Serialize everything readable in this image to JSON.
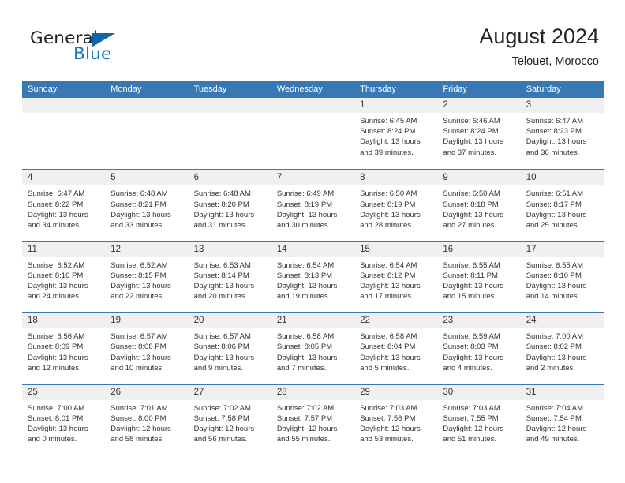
{
  "brand": {
    "name_part1": "General",
    "name_part2": "Blue",
    "accent_color": "#1878be"
  },
  "header": {
    "title": "August 2024",
    "location": "Telouet, Morocco"
  },
  "calendar": {
    "header_bg": "#3878b4",
    "day_band_bg": "#f0f0f0",
    "weekdays": [
      "Sunday",
      "Monday",
      "Tuesday",
      "Wednesday",
      "Thursday",
      "Friday",
      "Saturday"
    ],
    "weeks": [
      [
        {
          "day": "",
          "empty": true
        },
        {
          "day": "",
          "empty": true
        },
        {
          "day": "",
          "empty": true
        },
        {
          "day": "",
          "empty": true
        },
        {
          "day": "1",
          "sunrise": "Sunrise: 6:45 AM",
          "sunset": "Sunset: 8:24 PM",
          "daylight1": "Daylight: 13 hours",
          "daylight2": "and 39 minutes."
        },
        {
          "day": "2",
          "sunrise": "Sunrise: 6:46 AM",
          "sunset": "Sunset: 8:24 PM",
          "daylight1": "Daylight: 13 hours",
          "daylight2": "and 37 minutes."
        },
        {
          "day": "3",
          "sunrise": "Sunrise: 6:47 AM",
          "sunset": "Sunset: 8:23 PM",
          "daylight1": "Daylight: 13 hours",
          "daylight2": "and 36 minutes."
        }
      ],
      [
        {
          "day": "4",
          "sunrise": "Sunrise: 6:47 AM",
          "sunset": "Sunset: 8:22 PM",
          "daylight1": "Daylight: 13 hours",
          "daylight2": "and 34 minutes."
        },
        {
          "day": "5",
          "sunrise": "Sunrise: 6:48 AM",
          "sunset": "Sunset: 8:21 PM",
          "daylight1": "Daylight: 13 hours",
          "daylight2": "and 33 minutes."
        },
        {
          "day": "6",
          "sunrise": "Sunrise: 6:48 AM",
          "sunset": "Sunset: 8:20 PM",
          "daylight1": "Daylight: 13 hours",
          "daylight2": "and 31 minutes."
        },
        {
          "day": "7",
          "sunrise": "Sunrise: 6:49 AM",
          "sunset": "Sunset: 8:19 PM",
          "daylight1": "Daylight: 13 hours",
          "daylight2": "and 30 minutes."
        },
        {
          "day": "8",
          "sunrise": "Sunrise: 6:50 AM",
          "sunset": "Sunset: 8:19 PM",
          "daylight1": "Daylight: 13 hours",
          "daylight2": "and 28 minutes."
        },
        {
          "day": "9",
          "sunrise": "Sunrise: 6:50 AM",
          "sunset": "Sunset: 8:18 PM",
          "daylight1": "Daylight: 13 hours",
          "daylight2": "and 27 minutes."
        },
        {
          "day": "10",
          "sunrise": "Sunrise: 6:51 AM",
          "sunset": "Sunset: 8:17 PM",
          "daylight1": "Daylight: 13 hours",
          "daylight2": "and 25 minutes."
        }
      ],
      [
        {
          "day": "11",
          "sunrise": "Sunrise: 6:52 AM",
          "sunset": "Sunset: 8:16 PM",
          "daylight1": "Daylight: 13 hours",
          "daylight2": "and 24 minutes."
        },
        {
          "day": "12",
          "sunrise": "Sunrise: 6:52 AM",
          "sunset": "Sunset: 8:15 PM",
          "daylight1": "Daylight: 13 hours",
          "daylight2": "and 22 minutes."
        },
        {
          "day": "13",
          "sunrise": "Sunrise: 6:53 AM",
          "sunset": "Sunset: 8:14 PM",
          "daylight1": "Daylight: 13 hours",
          "daylight2": "and 20 minutes."
        },
        {
          "day": "14",
          "sunrise": "Sunrise: 6:54 AM",
          "sunset": "Sunset: 8:13 PM",
          "daylight1": "Daylight: 13 hours",
          "daylight2": "and 19 minutes."
        },
        {
          "day": "15",
          "sunrise": "Sunrise: 6:54 AM",
          "sunset": "Sunset: 8:12 PM",
          "daylight1": "Daylight: 13 hours",
          "daylight2": "and 17 minutes."
        },
        {
          "day": "16",
          "sunrise": "Sunrise: 6:55 AM",
          "sunset": "Sunset: 8:11 PM",
          "daylight1": "Daylight: 13 hours",
          "daylight2": "and 15 minutes."
        },
        {
          "day": "17",
          "sunrise": "Sunrise: 6:55 AM",
          "sunset": "Sunset: 8:10 PM",
          "daylight1": "Daylight: 13 hours",
          "daylight2": "and 14 minutes."
        }
      ],
      [
        {
          "day": "18",
          "sunrise": "Sunrise: 6:56 AM",
          "sunset": "Sunset: 8:09 PM",
          "daylight1": "Daylight: 13 hours",
          "daylight2": "and 12 minutes."
        },
        {
          "day": "19",
          "sunrise": "Sunrise: 6:57 AM",
          "sunset": "Sunset: 8:08 PM",
          "daylight1": "Daylight: 13 hours",
          "daylight2": "and 10 minutes."
        },
        {
          "day": "20",
          "sunrise": "Sunrise: 6:57 AM",
          "sunset": "Sunset: 8:06 PM",
          "daylight1": "Daylight: 13 hours",
          "daylight2": "and 9 minutes."
        },
        {
          "day": "21",
          "sunrise": "Sunrise: 6:58 AM",
          "sunset": "Sunset: 8:05 PM",
          "daylight1": "Daylight: 13 hours",
          "daylight2": "and 7 minutes."
        },
        {
          "day": "22",
          "sunrise": "Sunrise: 6:58 AM",
          "sunset": "Sunset: 8:04 PM",
          "daylight1": "Daylight: 13 hours",
          "daylight2": "and 5 minutes."
        },
        {
          "day": "23",
          "sunrise": "Sunrise: 6:59 AM",
          "sunset": "Sunset: 8:03 PM",
          "daylight1": "Daylight: 13 hours",
          "daylight2": "and 4 minutes."
        },
        {
          "day": "24",
          "sunrise": "Sunrise: 7:00 AM",
          "sunset": "Sunset: 8:02 PM",
          "daylight1": "Daylight: 13 hours",
          "daylight2": "and 2 minutes."
        }
      ],
      [
        {
          "day": "25",
          "sunrise": "Sunrise: 7:00 AM",
          "sunset": "Sunset: 8:01 PM",
          "daylight1": "Daylight: 13 hours",
          "daylight2": "and 0 minutes."
        },
        {
          "day": "26",
          "sunrise": "Sunrise: 7:01 AM",
          "sunset": "Sunset: 8:00 PM",
          "daylight1": "Daylight: 12 hours",
          "daylight2": "and 58 minutes."
        },
        {
          "day": "27",
          "sunrise": "Sunrise: 7:02 AM",
          "sunset": "Sunset: 7:58 PM",
          "daylight1": "Daylight: 12 hours",
          "daylight2": "and 56 minutes."
        },
        {
          "day": "28",
          "sunrise": "Sunrise: 7:02 AM",
          "sunset": "Sunset: 7:57 PM",
          "daylight1": "Daylight: 12 hours",
          "daylight2": "and 55 minutes."
        },
        {
          "day": "29",
          "sunrise": "Sunrise: 7:03 AM",
          "sunset": "Sunset: 7:56 PM",
          "daylight1": "Daylight: 12 hours",
          "daylight2": "and 53 minutes."
        },
        {
          "day": "30",
          "sunrise": "Sunrise: 7:03 AM",
          "sunset": "Sunset: 7:55 PM",
          "daylight1": "Daylight: 12 hours",
          "daylight2": "and 51 minutes."
        },
        {
          "day": "31",
          "sunrise": "Sunrise: 7:04 AM",
          "sunset": "Sunset: 7:54 PM",
          "daylight1": "Daylight: 12 hours",
          "daylight2": "and 49 minutes."
        }
      ]
    ]
  }
}
